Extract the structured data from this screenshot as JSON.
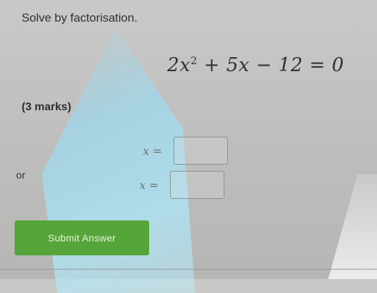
{
  "question": {
    "instruction": "Solve by factorisation.",
    "equation": {
      "coefficient_a": "2",
      "variable": "x",
      "exponent": "2",
      "rest": " + 5x − 12 = 0"
    },
    "marks": "(3 marks)"
  },
  "answers": [
    {
      "label": "x =",
      "value": ""
    },
    {
      "label": "x =",
      "value": ""
    }
  ],
  "separator": "or",
  "submit_label": "Submit Answer",
  "colors": {
    "submit_button": "#56a53a",
    "text": "#2e3034",
    "background": "#c4c4c2"
  }
}
